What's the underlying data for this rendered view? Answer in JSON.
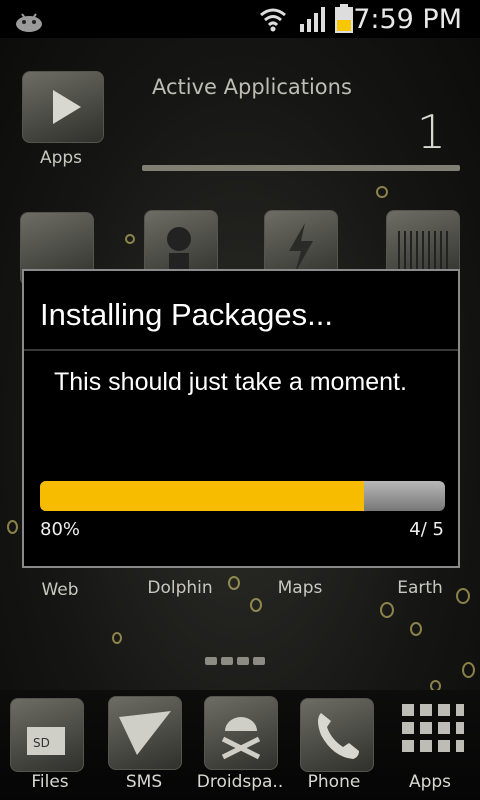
{
  "status_bar": {
    "time": "7:59 PM",
    "icons": [
      "android-notification-icon",
      "wifi-icon",
      "signal-icon",
      "battery-icon"
    ]
  },
  "widget": {
    "label": "Apps",
    "title": "Active Applications",
    "count": "1"
  },
  "home_apps": [
    {
      "label": "Web",
      "icon": "web-icon"
    },
    {
      "label": "Dolphin",
      "icon": "dolphin-icon"
    },
    {
      "label": "Maps",
      "icon": "maps-icon"
    },
    {
      "label": "Earth",
      "icon": "earth-icon"
    }
  ],
  "dock": [
    {
      "label": "Files",
      "icon": "files-icon"
    },
    {
      "label": "SMS",
      "icon": "sms-icon"
    },
    {
      "label": "Droidspa..",
      "icon": "droid-icon"
    },
    {
      "label": "Phone",
      "icon": "phone-icon"
    },
    {
      "label": "Apps",
      "icon": "app-grid-icon"
    }
  ],
  "dialog": {
    "title": "Installing Packages...",
    "message": "This should just take a moment.",
    "progress_fraction": 0.8,
    "progress_percent_label": "80%",
    "progress_count_label": "4/ 5",
    "accent_color": "#f7bc00"
  }
}
